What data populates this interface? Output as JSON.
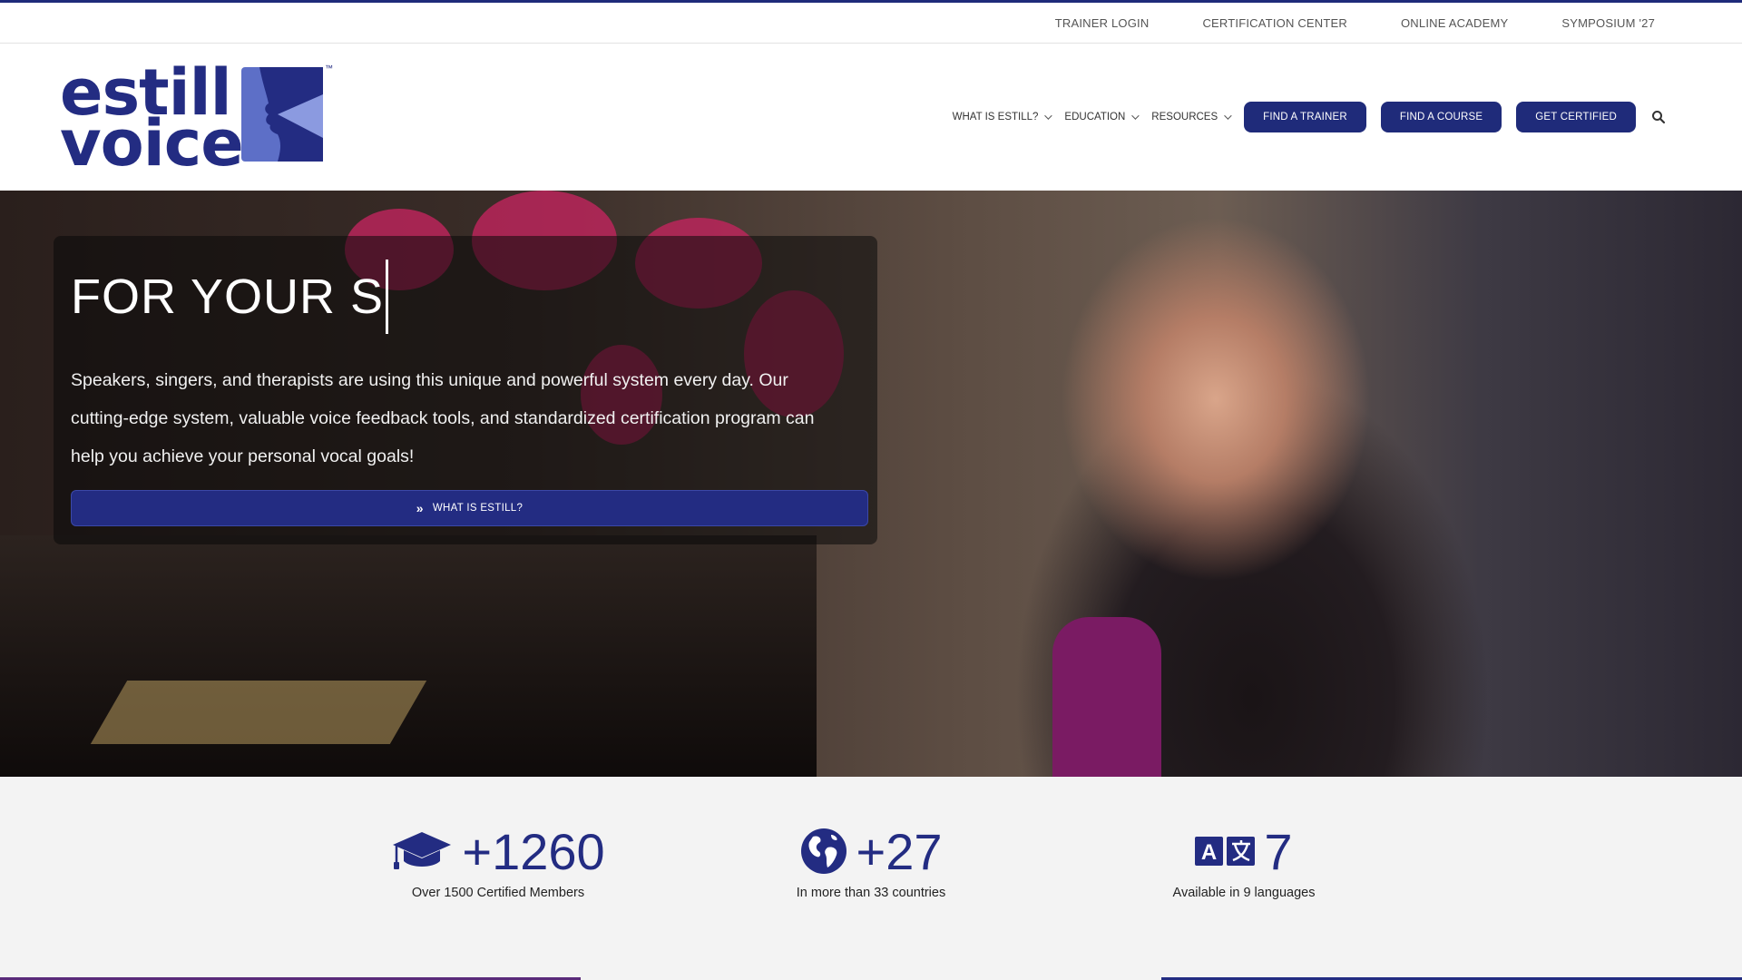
{
  "topbar": {
    "links": [
      "TRAINER LOGIN",
      "CERTIFICATION CENTER",
      "ONLINE ACADEMY",
      "SYMPOSIUM '27"
    ]
  },
  "logo": {
    "line1": "estill",
    "line2": "voice",
    "tm": "™"
  },
  "nav": {
    "menus": [
      "WHAT IS ESTILL?",
      "EDUCATION",
      "RESOURCES"
    ],
    "buttons": [
      "FIND A TRAINER",
      "FIND A COURSE",
      "GET CERTIFIED"
    ],
    "search_icon": "search-icon"
  },
  "hero": {
    "title": "FOR YOUR S",
    "text": "Speakers, singers, and therapists are using this unique and powerful system every day. Our cutting-edge system, valuable voice feedback tools, and standardized certification program can help you achieve your personal vocal goals!",
    "button_label": "WHAT IS ESTILL?"
  },
  "stats": [
    {
      "icon": "graduation-cap-icon",
      "number": "+1260",
      "label": "Over 1500 Certified Members"
    },
    {
      "icon": "globe-icon",
      "number": "+27",
      "label": "In more than 33 countries"
    },
    {
      "icon": "language-icon",
      "number": "7",
      "label": "Available in 9 languages"
    }
  ],
  "colors": {
    "brand": "#232c82",
    "accent_purple": "#5a2a7a"
  }
}
